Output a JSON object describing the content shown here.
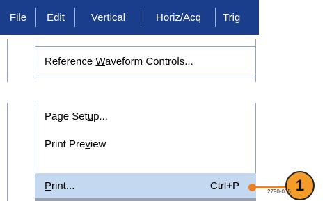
{
  "menubar": {
    "items": [
      {
        "label": "File"
      },
      {
        "label": "Edit"
      },
      {
        "label": "Vertical"
      },
      {
        "label": "Horiz/Acq"
      },
      {
        "label": "Trig"
      }
    ]
  },
  "menu": {
    "reference": {
      "pre": "Reference ",
      "mnemonic": "W",
      "post": "aveform Controls..."
    },
    "page_setup": {
      "pre": "Page Set",
      "mnemonic": "u",
      "post": "p..."
    },
    "print_preview": {
      "pre": "Print Pre",
      "mnemonic": "v",
      "post": "iew"
    },
    "print": {
      "pre": "",
      "mnemonic": "P",
      "post": "rint...",
      "shortcut": "Ctrl+P"
    }
  },
  "callout": {
    "number": "1"
  },
  "figure_id": "2790-035",
  "colors": {
    "menubar": "#1a3d8c",
    "highlight": "#c4d8ef",
    "callout": "#f39c2a"
  }
}
